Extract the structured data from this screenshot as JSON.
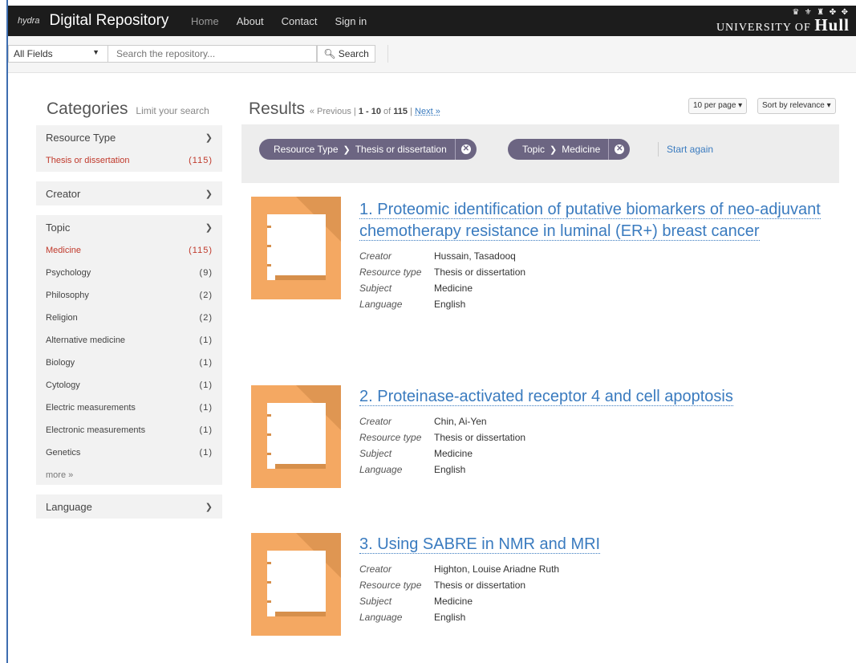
{
  "nav": {
    "logo": "hydra",
    "title": "Digital Repository",
    "links": [
      "Home",
      "About",
      "Contact",
      "Sign in"
    ],
    "university_small": "UNIVERSITY OF",
    "university_name": "Hull"
  },
  "search": {
    "field_select": "All Fields",
    "placeholder": "Search the repository...",
    "button": "Search"
  },
  "sidebar": {
    "title": "Categories",
    "subtitle": "Limit your search",
    "facets": {
      "resource_type": {
        "label": "Resource Type",
        "items": [
          {
            "label": "Thesis or dissertation",
            "count": "(115)"
          }
        ]
      },
      "creator": {
        "label": "Creator"
      },
      "topic": {
        "label": "Topic",
        "items": [
          {
            "label": "Medicine",
            "count": "(115)"
          },
          {
            "label": "Psychology",
            "count": "(9)"
          },
          {
            "label": "Philosophy",
            "count": "(2)"
          },
          {
            "label": "Religion",
            "count": "(2)"
          },
          {
            "label": "Alternative medicine",
            "count": "(1)"
          },
          {
            "label": "Biology",
            "count": "(1)"
          },
          {
            "label": "Cytology",
            "count": "(1)"
          },
          {
            "label": "Electric measurements",
            "count": "(1)"
          },
          {
            "label": "Electronic measurements",
            "count": "(1)"
          },
          {
            "label": "Genetics",
            "count": "(1)"
          }
        ],
        "more": "more »"
      },
      "language": {
        "label": "Language"
      }
    }
  },
  "results": {
    "title": "Results",
    "previous": "« Previous",
    "range": "1 - 10",
    "of": "of",
    "total": "115",
    "next": "Next »",
    "per_page": "10 per page",
    "sort": "Sort by relevance"
  },
  "constraints": [
    {
      "field": "Resource Type",
      "value": "Thesis or dissertation"
    },
    {
      "field": "Topic",
      "value": "Medicine"
    }
  ],
  "start_again": "Start again",
  "meta_labels": {
    "creator": "Creator",
    "resource_type": "Resource type",
    "subject": "Subject",
    "language": "Language"
  },
  "items": [
    {
      "title": "1. Proteomic identification of putative biomarkers of neo-adjuvant chemotherapy resistance in luminal (ER+) breast cancer",
      "creator": "Hussain, Tasadooq",
      "resource_type": "Thesis or dissertation",
      "subject": "Medicine",
      "language": "English"
    },
    {
      "title": "2. Proteinase-activated receptor 4 and cell apoptosis",
      "creator": "Chin, Ai-Yen",
      "resource_type": "Thesis or dissertation",
      "subject": "Medicine",
      "language": "English"
    },
    {
      "title": "3. Using SABRE in NMR and MRI",
      "creator": "Highton, Louise Ariadne Ruth",
      "resource_type": "Thesis or dissertation",
      "subject": "Medicine",
      "language": "English"
    }
  ],
  "colors": {
    "navbar": "#1c1c1c",
    "link": "#3a7bbf",
    "selected_facet": "#c0392b",
    "chip": "#6c6582",
    "thumb": "#f4a862"
  }
}
